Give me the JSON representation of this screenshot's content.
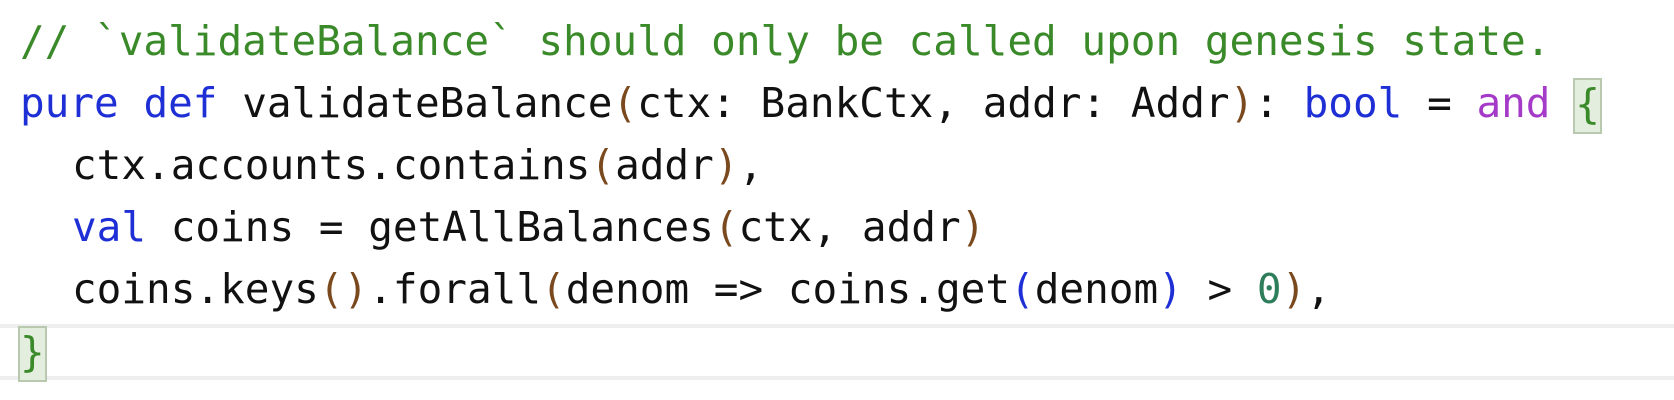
{
  "code": {
    "line1": {
      "comment": "// `validateBalance` should only be called upon genesis state."
    },
    "line2": {
      "kw_pure": "pure",
      "kw_def": "def",
      "func_name": "validateBalance",
      "paren_open": "(",
      "params": "ctx: BankCtx, addr: Addr",
      "paren_close": ")",
      "colon": ":",
      "return_type": "bool",
      "equals": "=",
      "kw_and": "and",
      "brace_open": "{"
    },
    "line3": {
      "call": "ctx.accounts.contains",
      "paren_open": "(",
      "arg": "addr",
      "paren_close": ")",
      "trailing": ","
    },
    "line4": {
      "kw_val": "val",
      "binding": "coins = getAllBalances",
      "paren_open": "(",
      "args": "ctx, addr",
      "paren_close": ")"
    },
    "line5": {
      "call1": "coins.keys",
      "paren_pair": "()",
      "call2": ".forall",
      "paren_open": "(",
      "lambda": "denom => coins.get",
      "inner_paren_open": "(",
      "inner_arg": "denom",
      "inner_paren_close": ")",
      "compare": " > ",
      "number": "0",
      "paren_close": ")",
      "trailing": ","
    },
    "line6": {
      "brace_close": "}"
    }
  },
  "colors": {
    "comment": "#3a8a2a",
    "keyword": "#1f2fd6",
    "operator_keyword": "#a53ac9",
    "paren_outer": "#7a4a1e",
    "paren_inner": "#1f2fd6",
    "number": "#2e7d5b"
  }
}
